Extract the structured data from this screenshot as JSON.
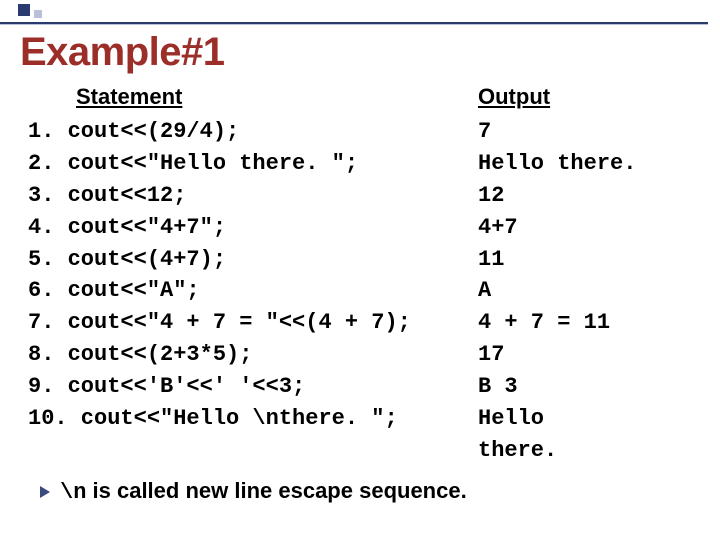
{
  "title": "Example#1",
  "headers": {
    "statement": "Statement",
    "output": "Output"
  },
  "statements": [
    "1. cout<<(29/4);",
    "2. cout<<\"Hello there. \";",
    "3. cout<<12;",
    "4. cout<<\"4+7\";",
    "5. cout<<(4+7);",
    "6. cout<<\"A\";",
    "7. cout<<\"4 + 7 = \"<<(4 + 7);",
    "8. cout<<(2+3*5);",
    "9. cout<<'B'<<' '<<3;",
    "10. cout<<\"Hello \\nthere. \";"
  ],
  "outputs": [
    "7",
    "Hello there.",
    "12",
    "4+7",
    "11",
    "A",
    "4 + 7 = 11",
    "17",
    "B 3",
    "Hello",
    "there."
  ],
  "note": {
    "esc": "\\n",
    "text": " is called new line escape sequence."
  }
}
